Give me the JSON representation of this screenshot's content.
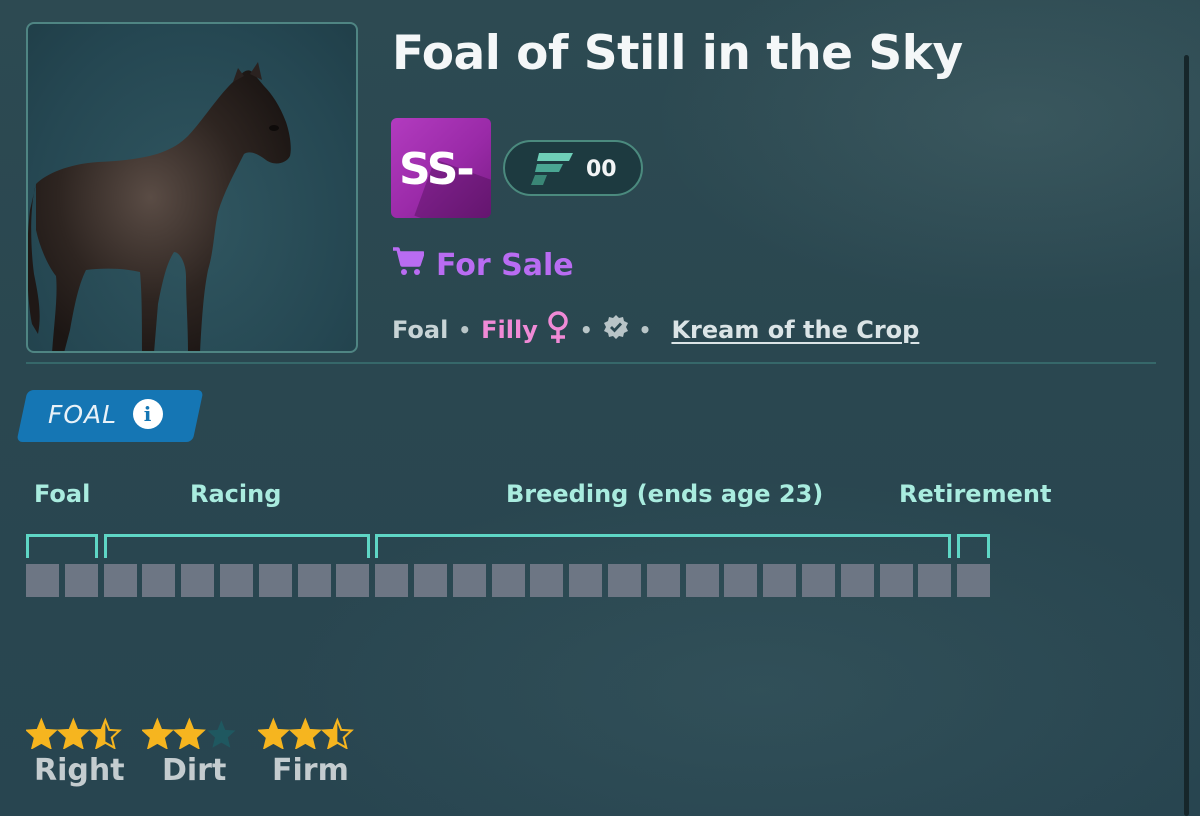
{
  "horse": {
    "name": "Foal of Still in the Sky",
    "grade": "SS-",
    "f_count": "00",
    "sale_status": "For Sale",
    "age_class": "Foal",
    "sex": "Filly",
    "stable": "Kream of the Crop"
  },
  "colors": {
    "grade_bg": "#a332b3",
    "sale": "#b96cf2",
    "filly": "#f08ad6",
    "phase_bracket": "#5ed6c5",
    "badge": "#1576b4",
    "star": "#f6b51f"
  },
  "lifecycle": {
    "badge": "FOAL",
    "phases": [
      {
        "label": "Foal",
        "cells": 2
      },
      {
        "label": "Racing",
        "cells": 7
      },
      {
        "label": "Breeding (ends age 23)",
        "cells": 15
      },
      {
        "label": "Retirement",
        "cells": 1
      }
    ],
    "total_cells": 25
  },
  "preferences": [
    {
      "label": "Right",
      "rating": 2.5,
      "max": 3
    },
    {
      "label": "Dirt",
      "rating": 2,
      "max": 3
    },
    {
      "label": "Firm",
      "rating": 2.5,
      "max": 3
    }
  ],
  "icons": {
    "sale": "cart-icon",
    "sex": "female-icon",
    "verified": "verified-badge-icon",
    "info": "info-icon",
    "f": "f-logo-icon"
  }
}
